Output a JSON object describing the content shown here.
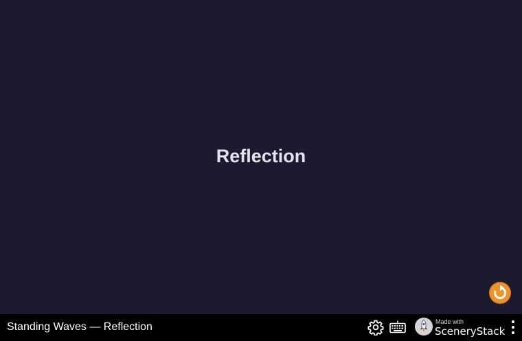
{
  "screen": {
    "title": "Reflection"
  },
  "navbar": {
    "sim_title": "Standing Waves — Reflection",
    "brand_made_with": "Made with",
    "brand_name": "SceneryStack"
  },
  "icons": {
    "reset": "reset-arrow-icon",
    "settings": "gear-icon",
    "keyboard": "keyboard-icon",
    "brand_logo": "rocket-logo-icon",
    "menu": "vertical-ellipsis-icon"
  },
  "colors": {
    "background": "#1c1a2e",
    "navbar": "#000000",
    "title_text": "#e4e3ec",
    "reset_button": "#f0922a"
  }
}
